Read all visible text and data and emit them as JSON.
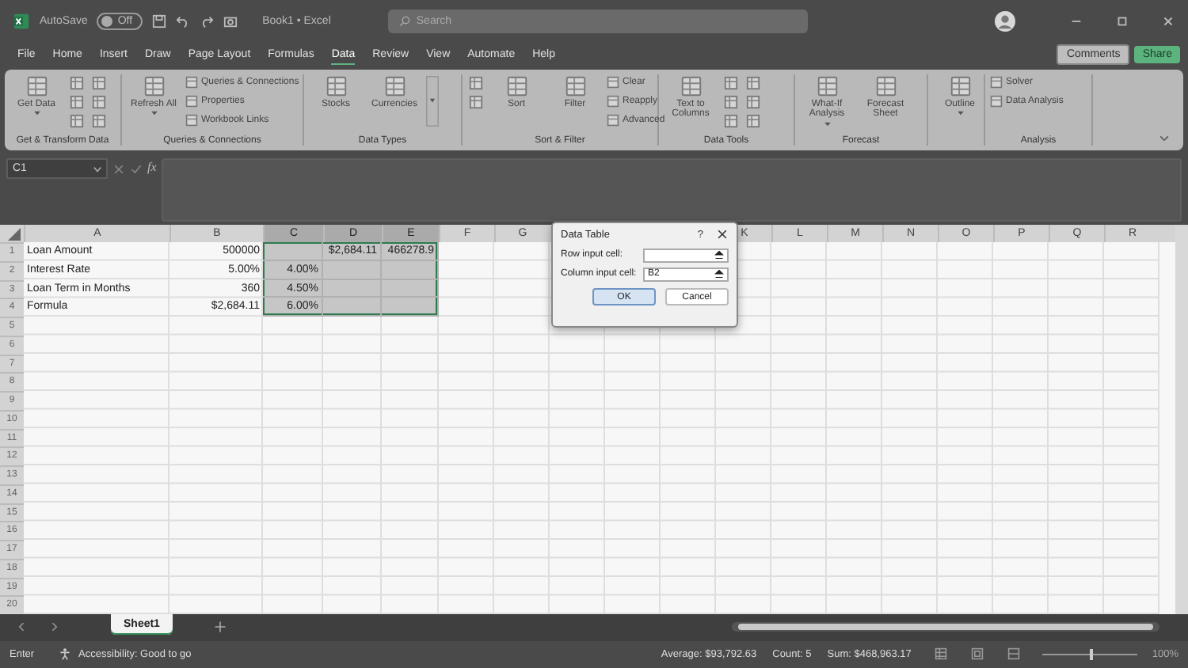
{
  "title_bar": {
    "autosave_label": "AutoSave",
    "autosave": {
      "on": false,
      "label": "Off"
    },
    "title": "Book1 • Excel",
    "search": {
      "placeholder": "Search"
    }
  },
  "menu": [
    {
      "label": "File",
      "selected": false
    },
    {
      "label": "Home",
      "selected": false
    },
    {
      "label": "Insert",
      "selected": false
    },
    {
      "label": "Draw",
      "selected": false
    },
    {
      "label": "Page Layout",
      "selected": false
    },
    {
      "label": "Formulas",
      "selected": false
    },
    {
      "label": "Data",
      "selected": true
    },
    {
      "label": "Review",
      "selected": false
    },
    {
      "label": "View",
      "selected": false
    },
    {
      "label": "Automate",
      "selected": false
    },
    {
      "label": "Help",
      "selected": false
    }
  ],
  "actions": [
    {
      "label": "Comments",
      "kind": "plain"
    },
    {
      "label": "Share",
      "kind": "primary"
    }
  ],
  "ribbon": [
    {
      "label": "Get & Transform Data",
      "items": [
        {
          "kind": "large",
          "label": "Get Data",
          "dropdown": true
        },
        {
          "kind": "icon"
        },
        {
          "kind": "icon"
        },
        {
          "kind": "icon"
        },
        {
          "kind": "icon"
        },
        {
          "kind": "icon"
        },
        {
          "kind": "icon"
        }
      ]
    },
    {
      "label": "Queries & Connections",
      "items": [
        {
          "kind": "large",
          "label": "Refresh All",
          "dropdown": true
        },
        {
          "kind": "small",
          "label": "Queries & Connections"
        },
        {
          "kind": "small",
          "label": "Properties"
        },
        {
          "kind": "small",
          "label": "Workbook Links"
        }
      ]
    },
    {
      "label": "Data Types",
      "items": [
        {
          "kind": "large",
          "label": "Stocks"
        },
        {
          "kind": "large",
          "label": "Currencies"
        },
        {
          "kind": "more"
        }
      ]
    },
    {
      "label": "Sort & Filter",
      "items": [
        {
          "kind": "icon"
        },
        {
          "kind": "icon"
        },
        {
          "kind": "large",
          "label": "Sort"
        },
        {
          "kind": "large",
          "label": "Filter"
        },
        {
          "kind": "small",
          "label": "Clear"
        },
        {
          "kind": "small",
          "label": "Reapply"
        },
        {
          "kind": "small",
          "label": "Advanced"
        }
      ]
    },
    {
      "label": "Data Tools",
      "items": [
        {
          "kind": "large",
          "label": "Text to Columns"
        },
        {
          "kind": "icon"
        },
        {
          "kind": "icon"
        },
        {
          "kind": "icon"
        },
        {
          "kind": "icon"
        },
        {
          "kind": "icon"
        },
        {
          "kind": "icon"
        }
      ]
    },
    {
      "label": "Forecast",
      "items": [
        {
          "kind": "large",
          "label": "What-If Analysis",
          "dropdown": true
        },
        {
          "kind": "large",
          "label": "Forecast Sheet"
        }
      ]
    },
    {
      "items": [
        {
          "kind": "large",
          "label": "Outline",
          "dropdown": true
        }
      ]
    },
    {
      "label": "Analysis",
      "items": [
        {
          "kind": "small",
          "label": "Solver"
        },
        {
          "kind": "small",
          "label": "Data Analysis"
        }
      ]
    }
  ],
  "formula_bar": {
    "name_box": "C1",
    "fx": "fx"
  },
  "grid": {
    "columns": [
      {
        "label": "A",
        "selected": false
      },
      {
        "label": "B",
        "selected": false
      },
      {
        "label": "C",
        "selected": true
      },
      {
        "label": "D",
        "selected": true
      },
      {
        "label": "E",
        "selected": true
      },
      {
        "label": "F",
        "selected": false
      },
      {
        "label": "G",
        "selected": false
      },
      {
        "kind": "covered"
      },
      {
        "kind": "covered"
      },
      {
        "kind": "covered"
      },
      {
        "label": "K",
        "selected": false
      },
      {
        "label": "L",
        "selected": false
      },
      {
        "label": "M",
        "selected": false
      },
      {
        "label": "N",
        "selected": false
      },
      {
        "label": "O",
        "selected": false
      },
      {
        "label": "P",
        "selected": false
      },
      {
        "label": "Q",
        "selected": false
      },
      {
        "label": "R",
        "selected": false
      }
    ],
    "rows": [
      {
        "number": "1",
        "cells": [
          {
            "value": "Loan Amount",
            "kind": "text",
            "selected": false
          },
          {
            "value": "500000",
            "kind": "number",
            "selected": false
          },
          {
            "kind": "number",
            "selected": true
          },
          {
            "value": "$2,684.11",
            "kind": "number",
            "selected": true
          },
          {
            "value": "466278.9",
            "kind": "number",
            "selected": true
          }
        ]
      },
      {
        "number": "2",
        "cells": [
          {
            "value": "Interest Rate",
            "kind": "text",
            "selected": false
          },
          {
            "value": "5.00%",
            "kind": "number",
            "selected": false
          },
          {
            "value": "4.00%",
            "kind": "number",
            "selected": true
          },
          {
            "kind": "number",
            "selected": true
          },
          {
            "kind": "number",
            "selected": true
          }
        ]
      },
      {
        "number": "3",
        "cells": [
          {
            "value": "Loan Term in Months",
            "kind": "text",
            "selected": false
          },
          {
            "value": "360",
            "kind": "number",
            "selected": false
          },
          {
            "value": "4.50%",
            "kind": "number",
            "selected": true
          },
          {
            "kind": "number",
            "selected": true
          },
          {
            "kind": "number",
            "selected": true
          }
        ]
      },
      {
        "number": "4",
        "cells": [
          {
            "value": "Formula",
            "kind": "text",
            "selected": false
          },
          {
            "value": "$2,684.11",
            "kind": "number",
            "selected": false
          },
          {
            "value": "6.00%",
            "kind": "number",
            "selected": true
          },
          {
            "kind": "number",
            "selected": true
          },
          {
            "kind": "number",
            "selected": true
          }
        ]
      },
      {
        "number": "5"
      },
      {
        "number": "6"
      },
      {
        "number": "7"
      },
      {
        "number": "8"
      },
      {
        "number": "9"
      },
      {
        "number": "10"
      },
      {
        "number": "11"
      },
      {
        "number": "12"
      },
      {
        "number": "13"
      },
      {
        "number": "14"
      },
      {
        "number": "15"
      },
      {
        "number": "16"
      },
      {
        "number": "17"
      },
      {
        "number": "18"
      },
      {
        "number": "19"
      },
      {
        "number": "20"
      }
    ]
  },
  "dialog": {
    "title": "Data Table",
    "help": "?",
    "fields": [
      {
        "label": "Row input cell:"
      },
      {
        "label": "Column input cell:",
        "value": "B2"
      }
    ],
    "buttons": [
      {
        "label": "OK",
        "default": true
      },
      {
        "label": "Cancel",
        "default": false
      }
    ]
  },
  "sheets": [
    {
      "label": "Sheet1",
      "selected": true
    }
  ],
  "status_bar": {
    "mode": "Enter",
    "accessibility": "Accessibility: Good to go",
    "stats": [
      "Average: $93,792.63",
      "Count: 5",
      "Sum: $468,963.17"
    ],
    "zoom": {
      "level": 0.5,
      "label": "100%"
    }
  }
}
